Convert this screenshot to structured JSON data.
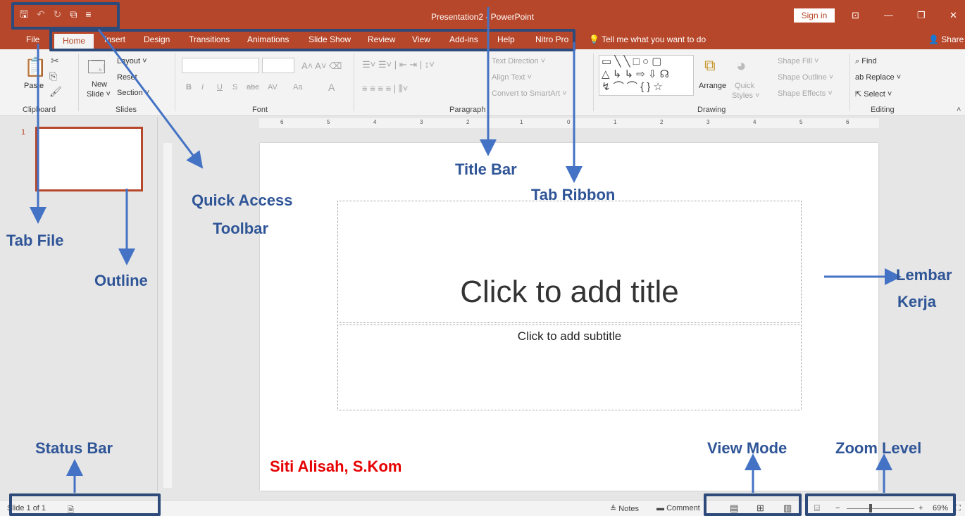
{
  "window": {
    "title": "Presentation2 - PowerPoint",
    "sign_in": "Sign in",
    "controls": {
      "ribbon_display": "⊡",
      "minimize": "—",
      "restore": "❐",
      "close": "✕"
    }
  },
  "quick_access": {
    "save": "🖫",
    "undo": "↶",
    "redo": "↻",
    "start_slideshow": "⧉",
    "customize": "≡"
  },
  "tabs": [
    {
      "label": "File"
    },
    {
      "label": "Home"
    },
    {
      "label": "Insert"
    },
    {
      "label": "Design"
    },
    {
      "label": "Transitions"
    },
    {
      "label": "Animations"
    },
    {
      "label": "Slide Show"
    },
    {
      "label": "Review"
    },
    {
      "label": "View"
    },
    {
      "label": "Add-ins"
    },
    {
      "label": "Help"
    },
    {
      "label": "Nitro Pro"
    }
  ],
  "tell_me": "Tell me what you want to do",
  "share": "Share",
  "ribbon": {
    "clipboard": {
      "label": "Clipboard",
      "paste": "Paste"
    },
    "slides": {
      "label": "Slides",
      "new_slide": "New",
      "new_slide_2": "Slide ˅",
      "layout": "Layout ˅",
      "reset": "Reset",
      "section": "Section ˅"
    },
    "font": {
      "label": "Font",
      "bold": "B",
      "italic": "I",
      "underline": "U",
      "shadow": "S",
      "strike": "abc",
      "spacing": "AV",
      "case": "Aa",
      "color": "A"
    },
    "paragraph": {
      "label": "Paragraph",
      "text_direction": "Text Direction ˅",
      "align_text": "Align Text ˅",
      "convert_smartart": "Convert to SmartArt ˅"
    },
    "drawing": {
      "label": "Drawing",
      "arrange": "Arrange",
      "quick_styles": "Quick",
      "quick_styles_2": "Styles ˅",
      "shape_fill": "Shape Fill ˅",
      "shape_outline": "Shape Outline ˅",
      "shape_effects": "Shape Effects ˅"
    },
    "editing": {
      "label": "Editing",
      "find": "Find",
      "replace": "Replace ˅",
      "select": "Select ˅"
    }
  },
  "thumbnail": {
    "number": "1"
  },
  "ruler_ticks": [
    "6",
    "5",
    "4",
    "3",
    "2",
    "1",
    "0",
    "1",
    "2",
    "3",
    "4",
    "5",
    "6"
  ],
  "slide": {
    "title_placeholder": "Click to add title",
    "subtitle_placeholder": "Click to add subtitle"
  },
  "status": {
    "slide_of": "Slide 1 of 1",
    "notes": "Notes",
    "comments": "Comment",
    "zoom": "69%",
    "zoom_minus": "−",
    "zoom_plus": "+"
  },
  "annotations": {
    "title_bar": "Title Bar",
    "tab_ribbon": "Tab Ribbon",
    "quick_access_1": "Quick Access",
    "quick_access_2": "Toolbar",
    "tab_file": "Tab File",
    "outline": "Outline",
    "lembar_kerja_1": "Lembar",
    "lembar_kerja_2": "Kerja",
    "status_bar": "Status Bar",
    "view_mode": "View Mode",
    "zoom_level": "Zoom Level",
    "author": "Siti Alisah, S.Kom"
  },
  "colors": {
    "accent": "#b7472a",
    "annotation": "#2f5597",
    "author": "#e60000"
  }
}
